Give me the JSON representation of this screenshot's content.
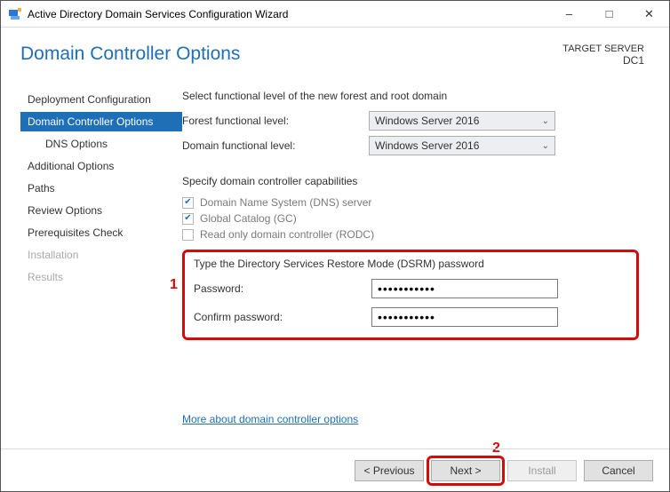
{
  "window": {
    "title": "Active Directory Domain Services Configuration Wizard"
  },
  "header": {
    "page_title": "Domain Controller Options",
    "target_label": "TARGET SERVER",
    "target_server": "DC1"
  },
  "sidebar": {
    "items": [
      {
        "label": "Deployment Configuration",
        "state": "normal"
      },
      {
        "label": "Domain Controller Options",
        "state": "selected"
      },
      {
        "label": "DNS Options",
        "state": "sub"
      },
      {
        "label": "Additional Options",
        "state": "normal"
      },
      {
        "label": "Paths",
        "state": "normal"
      },
      {
        "label": "Review Options",
        "state": "normal"
      },
      {
        "label": "Prerequisites Check",
        "state": "normal"
      },
      {
        "label": "Installation",
        "state": "disabled"
      },
      {
        "label": "Results",
        "state": "disabled"
      }
    ]
  },
  "main": {
    "functional_intro": "Select functional level of the new forest and root domain",
    "forest_label": "Forest functional level:",
    "forest_value": "Windows Server 2016",
    "domain_label": "Domain functional level:",
    "domain_value": "Windows Server 2016",
    "caps_intro": "Specify domain controller capabilities",
    "chk_dns": "Domain Name System (DNS) server",
    "chk_gc": "Global Catalog (GC)",
    "chk_rodc": "Read only domain controller (RODC)",
    "dsrm_intro": "Type the Directory Services Restore Mode (DSRM) password",
    "pw_label": "Password:",
    "pw_confirm_label": "Confirm password:",
    "pw_value": "•••••••••••",
    "pw_confirm_value": "•••••••••••",
    "more_link": "More about domain controller options"
  },
  "annotations": {
    "n1": "1",
    "n2": "2"
  },
  "footer": {
    "prev": "< Previous",
    "next": "Next >",
    "install": "Install",
    "cancel": "Cancel"
  }
}
